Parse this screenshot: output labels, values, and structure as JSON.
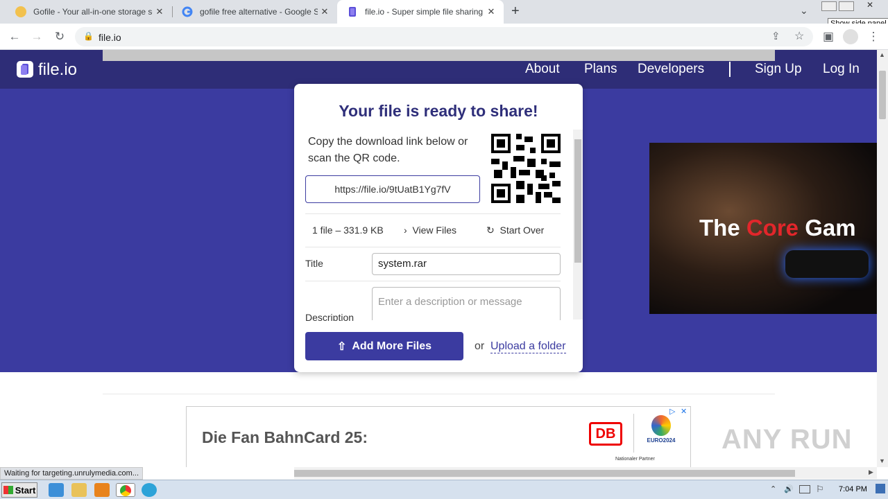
{
  "browser": {
    "tabs": [
      {
        "title": "Gofile - Your all-in-one storage soluti",
        "active": false
      },
      {
        "title": "gofile free alternative - Google Such",
        "active": false
      },
      {
        "title": "file.io - Super simple file sharing",
        "active": true
      }
    ],
    "new_tab": "+",
    "url": "file.io",
    "tooltip": "Show side panel"
  },
  "site": {
    "logo": "file.io",
    "nav": {
      "about": "About",
      "plans": "Plans",
      "developers": "Developers",
      "signup": "Sign Up",
      "login": "Log In"
    }
  },
  "card": {
    "heading": "Your file is ready to share!",
    "copy_text": "Copy the download link below or scan the QR code.",
    "link": "https://file.io/9tUatB1Yg7fV",
    "file_info": "1 file – 331.9 KB",
    "view_files": "View Files",
    "start_over": "Start Over",
    "title_label": "Title",
    "title_value": "system.rar",
    "description_label": "Description",
    "description_placeholder": "Enter a description or message",
    "add_more": "Add More Files",
    "or": "or",
    "upload_folder": "Upload a folder"
  },
  "ad": {
    "side_text_white_1": "The ",
    "side_text_red": "Core",
    "side_text_white_2": " Gam",
    "banner_text": "Die Fan BahnCard 25:",
    "banner_db": "DB",
    "banner_euro": "EURO2024",
    "banner_partner": "Nationaler Partner"
  },
  "status": "Waiting for targeting.unrulymedia.com...",
  "watermark": "ANY RUN",
  "taskbar": {
    "start": "Start",
    "time": "7:04 PM"
  },
  "colors": {
    "nav": "#2e2d77",
    "hero": "#3b3ba0",
    "accent": "#3b3ba0"
  }
}
